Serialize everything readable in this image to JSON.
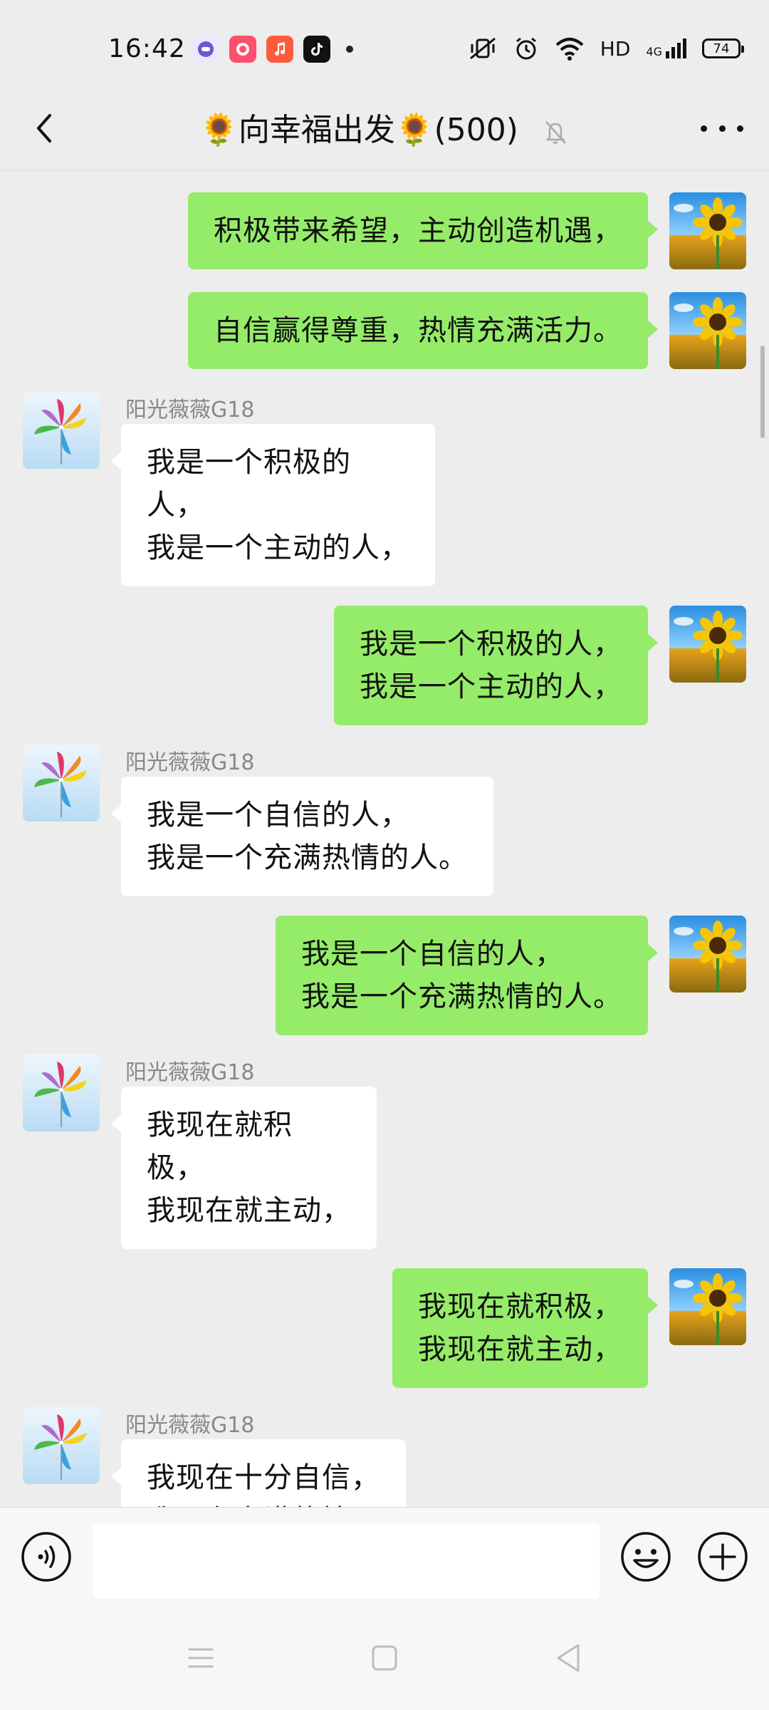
{
  "status_bar": {
    "time": "16:42",
    "network_label": "HD",
    "signal_label": "4G",
    "battery": "74",
    "apps": [
      {
        "icon": "app-icon-purple",
        "color": "#6a5acd"
      },
      {
        "icon": "app-icon-podcast",
        "color": "#ff4f6d"
      },
      {
        "icon": "music-icon",
        "color": "#ff5a3c"
      },
      {
        "icon": "tiktok-icon",
        "color": "#111111"
      }
    ]
  },
  "header": {
    "title": "🌻向幸福出发🌻(500)"
  },
  "messages": [
    {
      "side": "right",
      "text": "积极带来希望，主动创造机遇，"
    },
    {
      "side": "right",
      "text": "自信赢得尊重，热情充满活力。"
    },
    {
      "side": "left",
      "sender": "阳光薇薇G18",
      "text": "我是一个积极的\n人，\n我是一个主动的人，"
    },
    {
      "side": "right",
      "text": "我是一个积极的人，\n我是一个主动的人，"
    },
    {
      "side": "left",
      "sender": "阳光薇薇G18",
      "text": "我是一个自信的人，\n我是一个充满热情的人。"
    },
    {
      "side": "right",
      "text": "我是一个自信的人，\n我是一个充满热情的人。"
    },
    {
      "side": "left",
      "sender": "阳光薇薇G18",
      "text": "我现在就积\n极，\n我现在就主动，"
    },
    {
      "side": "right",
      "text": "我现在就积极，\n我现在就主动，"
    },
    {
      "side": "left",
      "sender": "阳光薇薇G18",
      "text": "我现在十分自信，\n我现在充满热情"
    }
  ],
  "input": {
    "value": "",
    "placeholder": ""
  },
  "colors": {
    "background": "#ededed",
    "my_bubble": "#95ec69",
    "their_bubble": "#ffffff"
  }
}
